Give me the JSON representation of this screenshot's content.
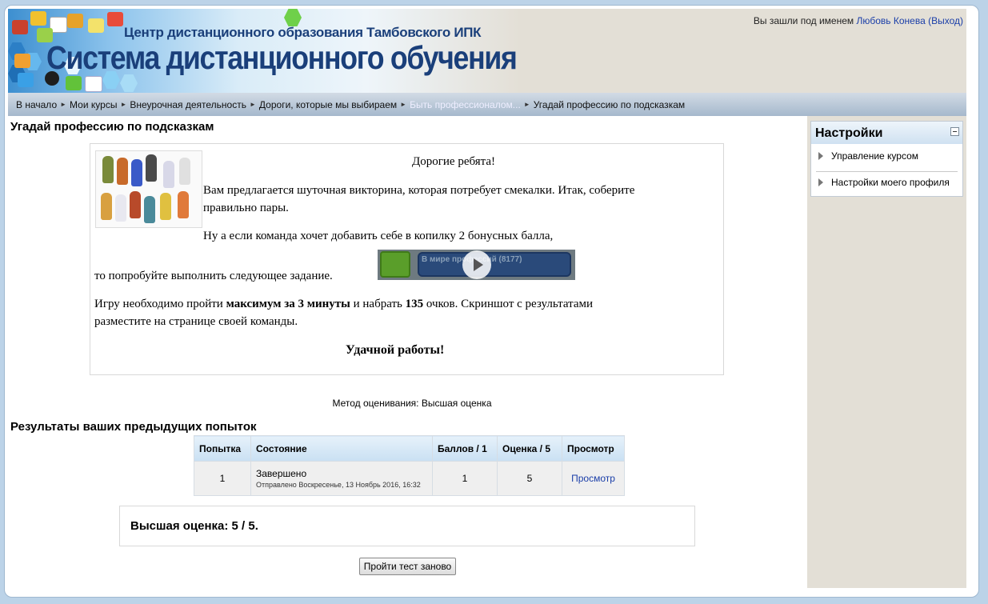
{
  "header": {
    "subtitle": "Центр дистанционного образования Тамбовского ИПК",
    "title": "Система дистанционного обучения",
    "login_prefix": "Вы зашли под именем",
    "user_name": "Любовь Конева",
    "logout_label": "(Выход)"
  },
  "breadcrumb": [
    "В начало",
    "Мои курсы",
    "Внеурочная деятельность",
    "Дороги, которые мы выбираем",
    "Быть профессионалом...",
    "Угадай профессию по подсказкам"
  ],
  "page_title": "Угадай профессию по подсказкам",
  "intro": {
    "greeting": "Дорогие ребята!",
    "line1": "Вам предлагается шуточная викторина, которая потребует смекалки. Итак, соберите",
    "line1b": "правильно пары.",
    "line2": "Ну а если команда хочет добавить себе в копилку 2 бонусных балла,",
    "line3": "то попробуйте выполнить следующее задание.",
    "video_title": "В мире профессий (8177)",
    "rules_a": "Игру необходимо пройти ",
    "rules_b": "максимум за 3 минуты",
    "rules_c": " и набрать ",
    "rules_d": "135",
    "rules_e": " очков. Скриншот с результатами",
    "rules_f": "разместите на странице своей команды.",
    "good_luck": "Удачной работы!"
  },
  "grading_method": "Метод оценивания: Высшая оценка",
  "results_heading": "Результаты ваших предыдущих попыток",
  "table": {
    "headers": [
      "Попытка",
      "Состояние",
      "Баллов / 1",
      "Оценка / 5",
      "Просмотр"
    ],
    "row": {
      "attempt": "1",
      "state": "Завершено",
      "submitted": "Отправлено Воскресенье, 13 Ноябрь 2016, 16:32",
      "marks": "1",
      "grade": "5",
      "review": "Просмотр"
    }
  },
  "best_grade": "Высшая оценка: 5 / 5.",
  "retry_button": "Пройти тест заново",
  "settings": {
    "title": "Настройки",
    "items": [
      "Управление курсом",
      "Настройки моего профиля"
    ]
  }
}
